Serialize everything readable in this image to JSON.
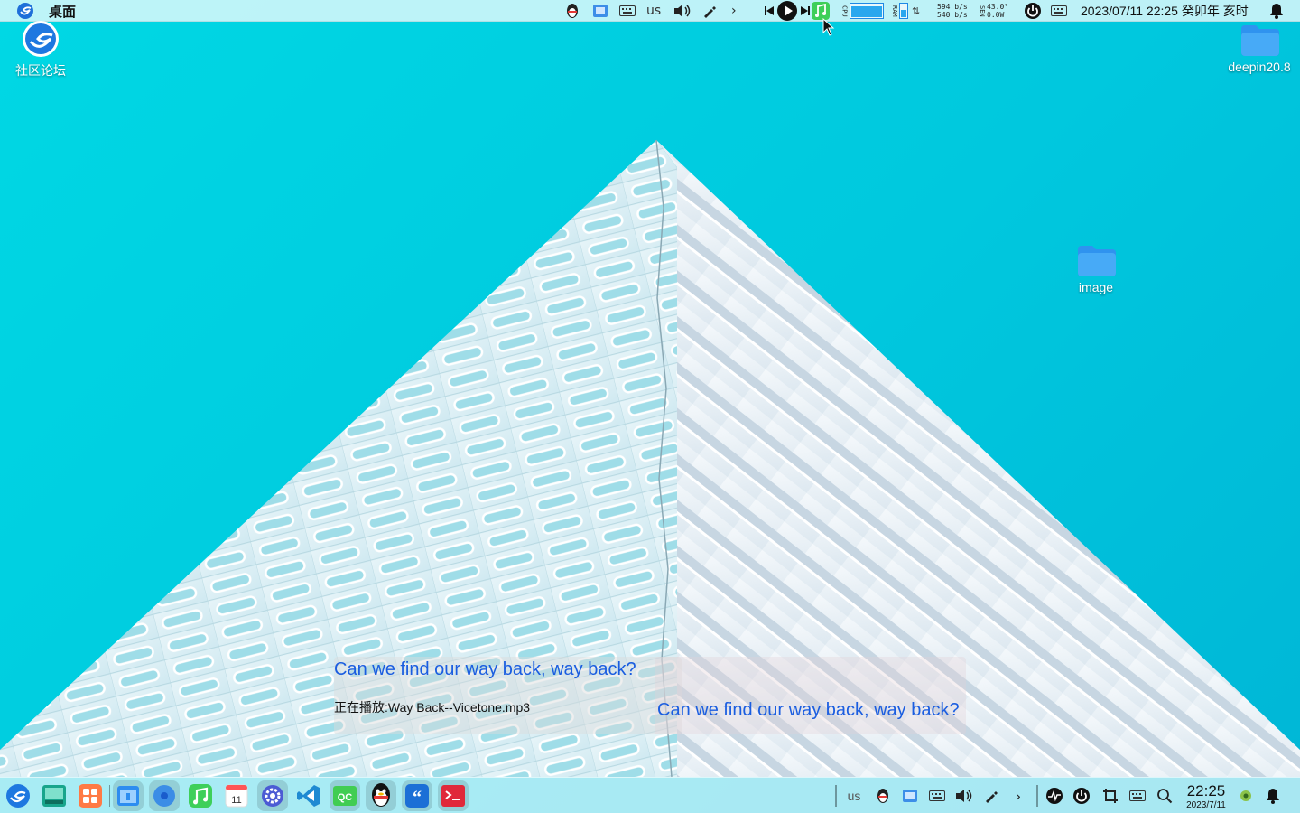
{
  "top_bar": {
    "title": "桌面",
    "input_method": "us",
    "net_up": "594 b/s",
    "net_down": "540 b/s",
    "sensor_temp": "43.0°",
    "sensor_power": "0.0W",
    "cpu_label": "CPU",
    "ram_label": "RAM",
    "clock": "2023/07/11  22:25 癸卯年  亥时"
  },
  "desktop": {
    "icons": [
      {
        "label": "社区论坛",
        "icon": "deepin-forum-icon"
      },
      {
        "label": "deepin20.8",
        "icon": "folder-icon"
      },
      {
        "label": "image",
        "icon": "folder-icon"
      }
    ]
  },
  "lyrics": {
    "line1": "Can we find our way back, way back?",
    "now_playing": "正在播放:Way Back--Vicetone.mp3",
    "line2": "Can we find our way back, way back?"
  },
  "dock": {
    "apps": [
      {
        "name": "launcher",
        "icon": "deepin-launcher-icon"
      },
      {
        "name": "multitasking",
        "icon": "multitasking-icon"
      },
      {
        "name": "app-store",
        "icon": "app-store-icon"
      },
      {
        "name": "file-manager",
        "icon": "file-manager-icon"
      },
      {
        "name": "browser",
        "icon": "browser-icon"
      },
      {
        "name": "music",
        "icon": "music-icon"
      },
      {
        "name": "calendar",
        "icon": "calendar-icon"
      },
      {
        "name": "control-center",
        "icon": "control-center-icon"
      },
      {
        "name": "vscode",
        "icon": "vscode-icon"
      },
      {
        "name": "qt-creator",
        "icon": "qt-creator-icon"
      },
      {
        "name": "qq",
        "icon": "qq-icon"
      },
      {
        "name": "quote-app",
        "icon": "quote-icon"
      },
      {
        "name": "terminal",
        "icon": "terminal-icon"
      }
    ],
    "calendar_day": "11",
    "qt_label": "QC",
    "input_method": "us",
    "time": "22:25",
    "date": "2023/7/11"
  },
  "colors": {
    "sky": "#00d2e2",
    "lyric_blue": "#1a5de0",
    "folder_blue": "#3aa4f5"
  }
}
